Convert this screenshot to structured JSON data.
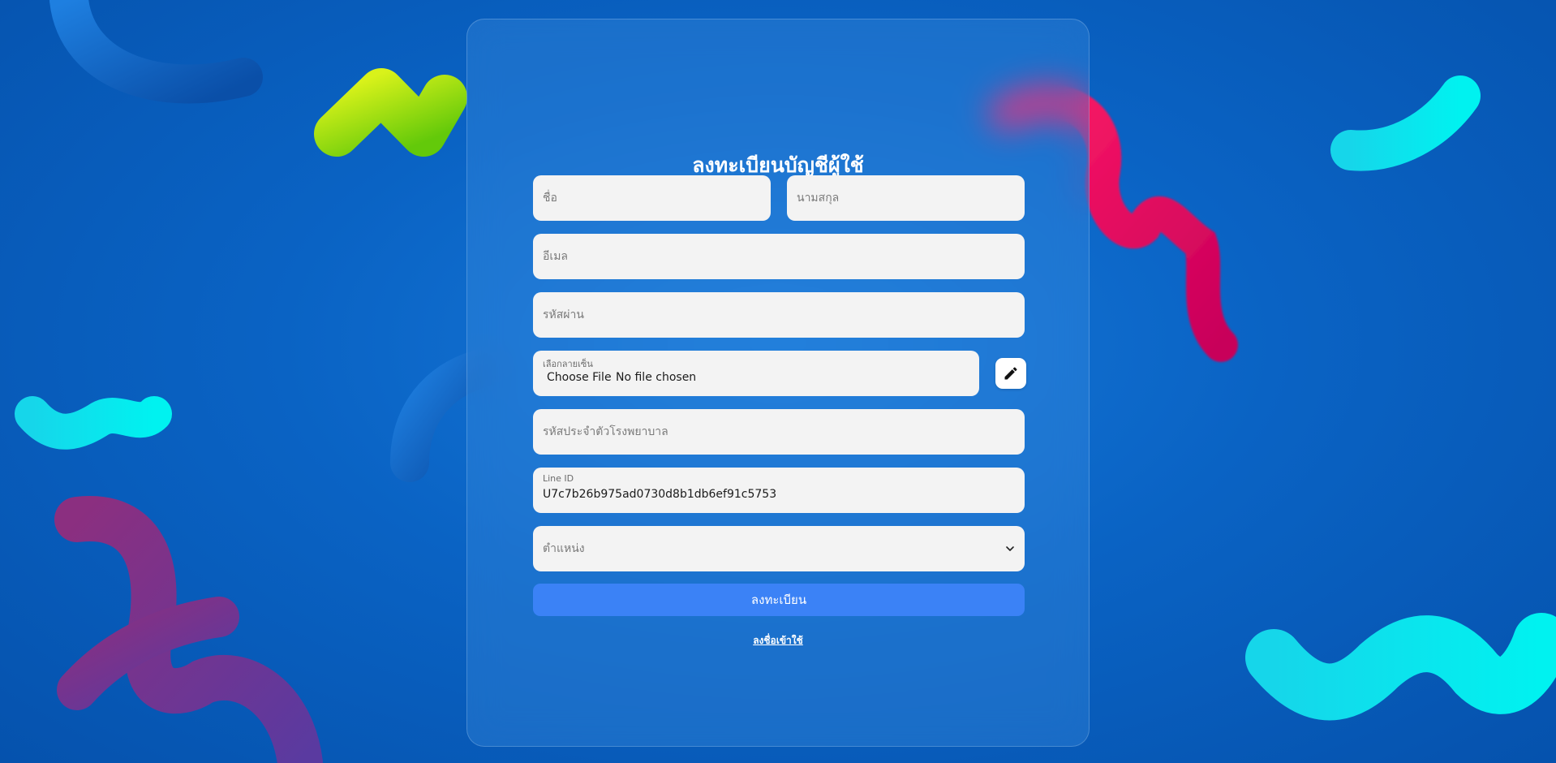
{
  "form": {
    "title": "ลงทะเบียนบัญชีผู้ใช้",
    "first_name_placeholder": "ชื่อ",
    "last_name_placeholder": "นามสกุล",
    "email_placeholder": "อีเมล",
    "password_placeholder": "รหัสผ่าน",
    "signature": {
      "label": "เลือกลายเซ็น",
      "button_label": "Choose File",
      "status": "No file chosen"
    },
    "hospital_code_placeholder": "รหัสประจำตัวโรงพยาบาล",
    "line_id": {
      "label": "Line ID",
      "value": "U7c7b26b975ad0730d8b1db6ef91c5753"
    },
    "position_placeholder": "ตำแหน่ง",
    "submit_label": "ลงทะเบียน",
    "login_link": "ลงชื่อเข้าใช้"
  },
  "icons": {
    "edit": "pencil-icon",
    "dropdown": "chevron-down-icon"
  },
  "colors": {
    "background": "#0a63c4",
    "primary_button": "#3b82f6",
    "input_bg": "#f3f3f3"
  }
}
